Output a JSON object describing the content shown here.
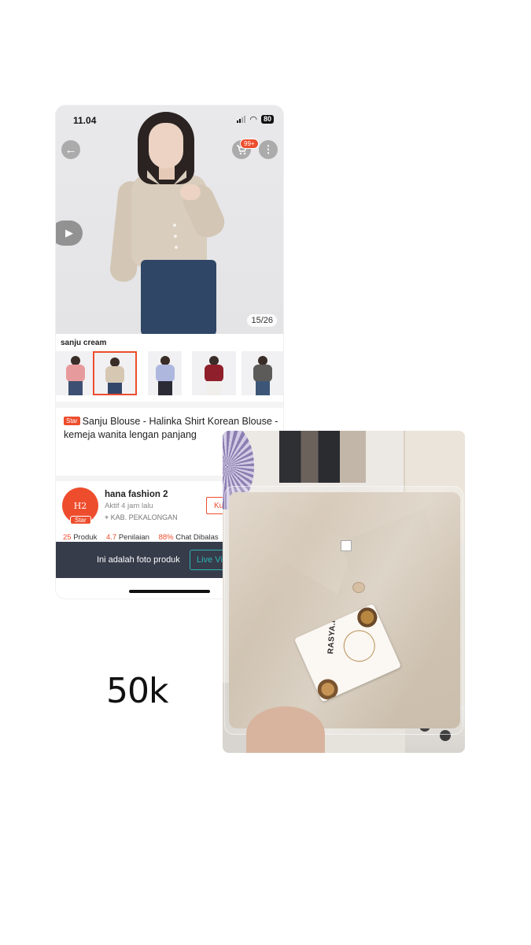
{
  "phone": {
    "status": {
      "time": "11.04",
      "battery": "80"
    },
    "cart_badge": "99+",
    "image_counter": "15/26",
    "variant_label": "sanju cream",
    "variants": [
      {
        "name": "pink",
        "top_color": "#e79a9c",
        "bottom_color": "#3d4f72"
      },
      {
        "name": "cream",
        "top_color": "#d6c7b3",
        "bottom_color": "#33476a"
      },
      {
        "name": "blue",
        "top_color": "#aeb7de",
        "bottom_color": "#2b2b35"
      },
      {
        "name": "maroon",
        "top_color": "#8f1f2b",
        "bottom_color": "#f1efec"
      },
      {
        "name": "gray",
        "top_color": "#5c5b5a",
        "bottom_color": "#3d5678"
      }
    ],
    "product": {
      "badge": "Star",
      "title": "Sanju Blouse - Halinka Shirt Korean Blouse - kemeja wanita lengan panjang"
    },
    "shop": {
      "logo_text": "H2",
      "logo_badge": "Star",
      "name": "hana fashion 2",
      "active": "Aktif 4 jam lalu",
      "location": "KAB. PEKALONGAN",
      "visit_label": "Ku",
      "stats": [
        {
          "value": "25",
          "label": "Produk"
        },
        {
          "value": "4.7",
          "label": "Penilaian"
        },
        {
          "value": "88%",
          "label": "Chat Dibalas"
        }
      ]
    },
    "banner": {
      "text": "Ini adalah foto produk",
      "live_label": "Live Vi"
    },
    "icons": {
      "back": "back-arrow-icon",
      "cart": "cart-icon",
      "more": "more-vertical-icon",
      "play": "play-icon",
      "location": "location-pin-icon"
    },
    "accent_color": "#ee4d2d"
  },
  "price_text": "50k",
  "photo": {
    "tag_brand": "RASYA.ID"
  }
}
